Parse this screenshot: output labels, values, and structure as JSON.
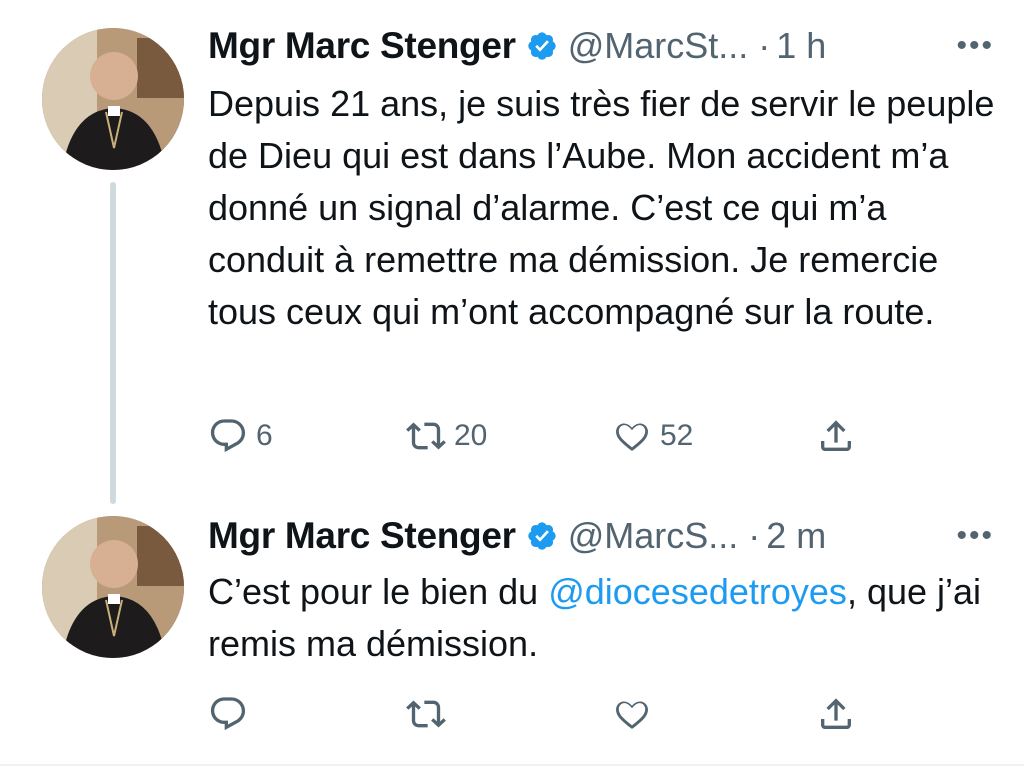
{
  "tweets": [
    {
      "name": "Mgr Marc Stenger",
      "handle": "@MarcSt...",
      "separator": "·",
      "time": "1 h",
      "text": "Depuis 21 ans, je suis très fier de servir le peuple de Dieu qui est dans l’Aube. Mon accident m’a donné un signal d’alarme. C’est ce qui m’a conduit à remettre ma démission. Je remercie tous ceux qui m’ont accompagné sur la route.",
      "replies": "6",
      "retweets": "20",
      "likes": "52"
    },
    {
      "name": "Mgr Marc Stenger",
      "handle": "@MarcS...",
      "separator": "·",
      "time": "2 m",
      "text_before": "C’est pour le bien du ",
      "mention": "@diocesedetroyes",
      "text_after": ", que j’ai remis ma démission.",
      "replies": "",
      "retweets": "",
      "likes": ""
    }
  ],
  "more_label": "•••",
  "colors": {
    "accent": "#1d9bf0",
    "secondary_text": "#536471",
    "primary_text": "#0f1419",
    "thread_line": "#cfd9de"
  },
  "icons": [
    "verified-badge-icon",
    "reply-icon",
    "retweet-icon",
    "like-icon",
    "share-icon",
    "more-icon"
  ]
}
